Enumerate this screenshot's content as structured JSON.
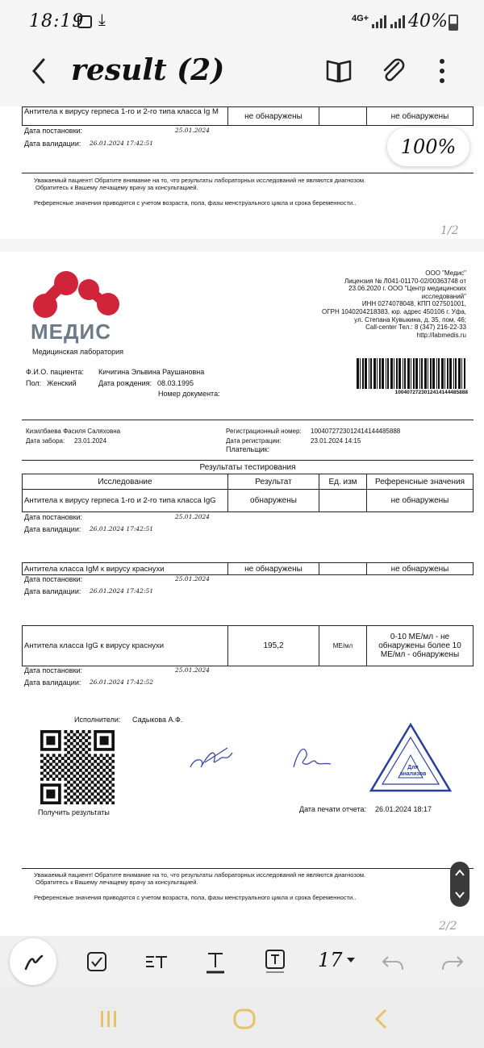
{
  "status_bar": {
    "time": "18:19",
    "network": "4G+",
    "battery": "40%"
  },
  "app_bar": {
    "title": "result (2)"
  },
  "viewer": {
    "zoom": "100%",
    "page1_indicator": "1/2",
    "page2_indicator": "2/2"
  },
  "page1": {
    "row_title": "Антитела к вирусу герпеса 1-го и 2-го типа класса Ig M",
    "row_result": "не обнаружены",
    "row_reference": "не обнаружены",
    "date_label_received": "Дата постановки:",
    "date_received": "25.01.2024",
    "date_label_validated": "Дата валидации:",
    "date_validated": "26.01.2024 17:42:51",
    "notice_line1": "Уважаемый пациент! Обратите внимание на то, что результаты лабораторных исследований не являются диагнозом.",
    "notice_line2": "Обратитесь к Вашему лечащему врачу за консультацией.",
    "notice_line3": "Референсные значения приводятся с учетом возраста, пола, фазы менструального цикла и срока беременности.."
  },
  "page2": {
    "logo_text": "МЕДИС",
    "logo_sub": "Медицинская лаборатория",
    "company_lines": [
      "ООО \"Медис\"",
      "Лицензия № Л041-01170-02/00363748 от",
      "23.06.2020 г. ООО \"Центр медицинских",
      "исследований\"",
      "ИНН 0274078048, КПП 027501001,",
      "ОГРН 1040204218383, юр. адрес 450106 г. Уфа,",
      "ул. Степана Кувыкина, д. 35, пом. 46;",
      "Call-center Тел.: 8 (347) 216-22-33",
      "http://labmedis.ru"
    ],
    "patient_label": "Ф.И.О. пациента:",
    "patient_name": "Кичигина Эльвина Раушановна",
    "sex_label": "Пол:",
    "sex": "Женский",
    "dob_label": "Дата рождения:",
    "dob": "08.03.1995",
    "docnum_label": "Номер документа:",
    "payer_label": "Плательщик:",
    "barcode_number": "1004072723012414144485888",
    "doctor_name": "Кизилбаева Фасиля Саляховна",
    "collect_label": "Дата забора:",
    "collect_date": "23.01.2024",
    "reg_number_label": "Регистрационный номер:",
    "reg_number": "1004072723012414144485888",
    "reg_date_label": "Дата регистрации:",
    "reg_date": "23.01.2024 14:15",
    "results_title": "Результаты тестирования",
    "table_headers": [
      "Исследование",
      "Результат",
      "Ед. изм",
      "Референсные значения"
    ],
    "rows": [
      {
        "test": "Антитела к вирусу герпеса 1-го и 2-го типа класса IgG",
        "result": "обнаружены",
        "unit": "",
        "reference": "не обнаружены",
        "date_received": "25.01.2024",
        "date_validated": "26.01.2024 17:42:51"
      },
      {
        "test": "Антитела класса IgM к вирусу краснухи",
        "result": "не обнаружены",
        "unit": "",
        "reference": "не обнаружены",
        "date_received": "25.01.2024",
        "date_validated": "26.01.2024 17:42:51"
      },
      {
        "test": "Антитела класса IgG к вирусу краснухи",
        "result": "195,2",
        "unit": "МЕ/мл",
        "reference": "0-10 МЕ/мл - не обнаружены более 10 МЕ/мл - обнаружены",
        "date_received": "25.01.2024",
        "date_validated": "26.01.2024 17:42:52"
      }
    ],
    "date_label_received": "Дата постановки:",
    "date_label_validated": "Дата валидации:",
    "executors_label": "Исполнители:",
    "executors": "Садыкова А.Ф.",
    "qr_caption": "Получить результаты",
    "print_date_label": "Дата печати отчета:",
    "print_date": "26.01.2024 18:17",
    "stamp_text": "Для анализов",
    "notice_line1": "Уважаемый пациент! Обратите внимание на то, что результаты лабораторных исследований не являются диагнозом.",
    "notice_line2": "Обратитесь к Вашему лечащему врачу за консультацией.",
    "notice_line3": "Референсные значения приводятся с учетом возраста, пола, фазы менструального цикла и срока беременности.."
  },
  "toolbar": {
    "font_size": "17"
  },
  "colors": {
    "accent_red": "#d0243a",
    "logo_gray": "#6d7a89",
    "nav_icon": "#e8c26a",
    "stamp_blue": "#2a3d9a"
  }
}
